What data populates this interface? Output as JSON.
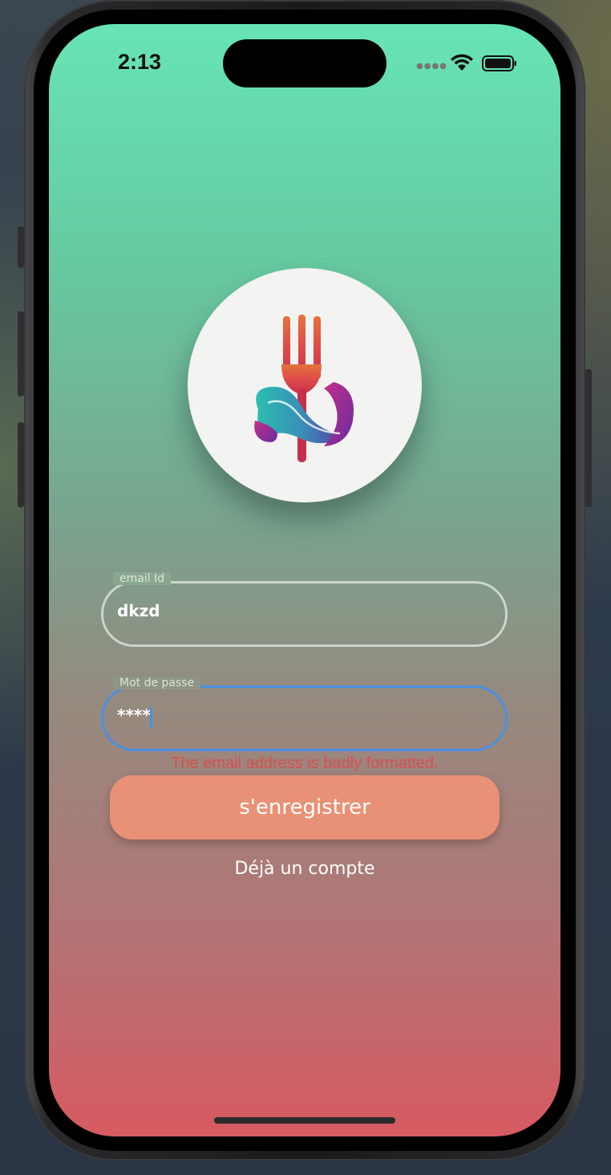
{
  "status_bar": {
    "time": "2:13",
    "signal_icon": "cellular-signal-icon",
    "wifi_icon": "wifi-icon",
    "battery_icon": "battery-icon"
  },
  "logo": {
    "icon": "fork-logo-icon"
  },
  "form": {
    "email": {
      "label": "email Id",
      "value": "dkzd"
    },
    "password": {
      "label": "Mot de passe",
      "value": "****"
    },
    "error": "The email address is badly formatted."
  },
  "actions": {
    "register_label": "s'enregistrer",
    "login_link": "Déjà un compte"
  },
  "colors": {
    "gradient_top": "#67e4b5",
    "gradient_bottom": "#d75a62",
    "button": "#e89176",
    "error": "#d8504f",
    "focus": "#4a90e2"
  }
}
